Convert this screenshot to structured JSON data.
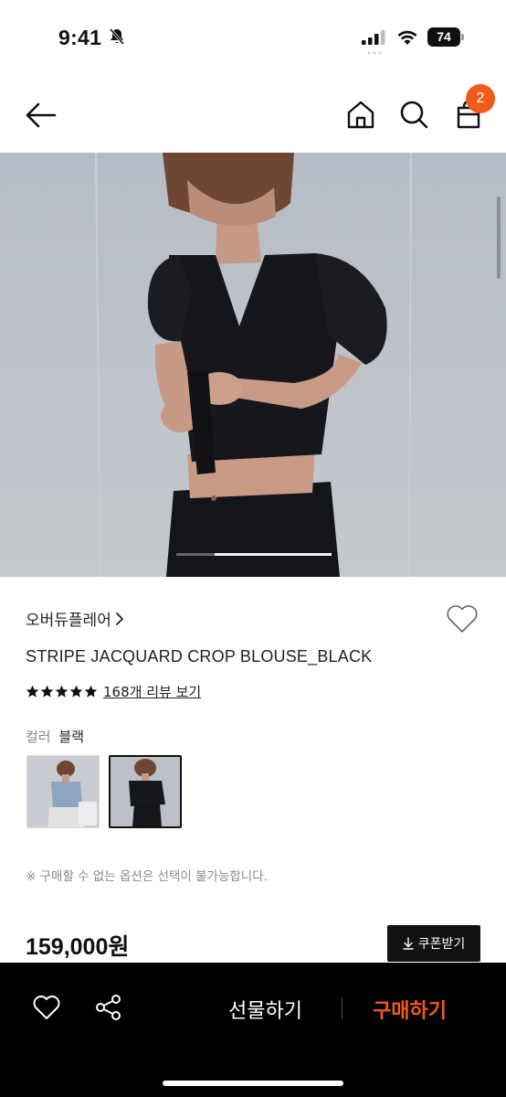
{
  "status_bar": {
    "time": "9:41",
    "battery": "74"
  },
  "nav": {
    "cart_count": "2"
  },
  "product": {
    "brand": "오버듀플레어",
    "title": "STRIPE JACQUARD CROP BLOUSE_BLACK",
    "rating_stars": 5,
    "review_link": "168개 리뷰 보기",
    "option_label": "컬러",
    "option_value": "블랙",
    "swatches": [
      {
        "name": "light",
        "selected": false
      },
      {
        "name": "black",
        "selected": true
      }
    ],
    "notice": "※ 구매할 수 없는 옵션은 선택이 불가능합니다.",
    "price": "159,000원",
    "coupon_label": "쿠폰받기"
  },
  "image_pager": {
    "total_pages": 2,
    "current_page": 2
  },
  "bottom_bar": {
    "gift_label": "선물하기",
    "buy_label": "구매하기"
  },
  "colors": {
    "accent": "#f25a1b",
    "bottom_bar_bg": "#000000",
    "text_primary": "#222222",
    "text_secondary": "#8a8a8a"
  },
  "icons": [
    "bell-off-icon",
    "signal-icon",
    "wifi-icon",
    "battery-icon",
    "back-arrow-icon",
    "home-icon",
    "search-icon",
    "shopping-bag-icon",
    "chevron-right-icon",
    "heart-icon",
    "star-icon",
    "download-icon",
    "share-icon"
  ]
}
